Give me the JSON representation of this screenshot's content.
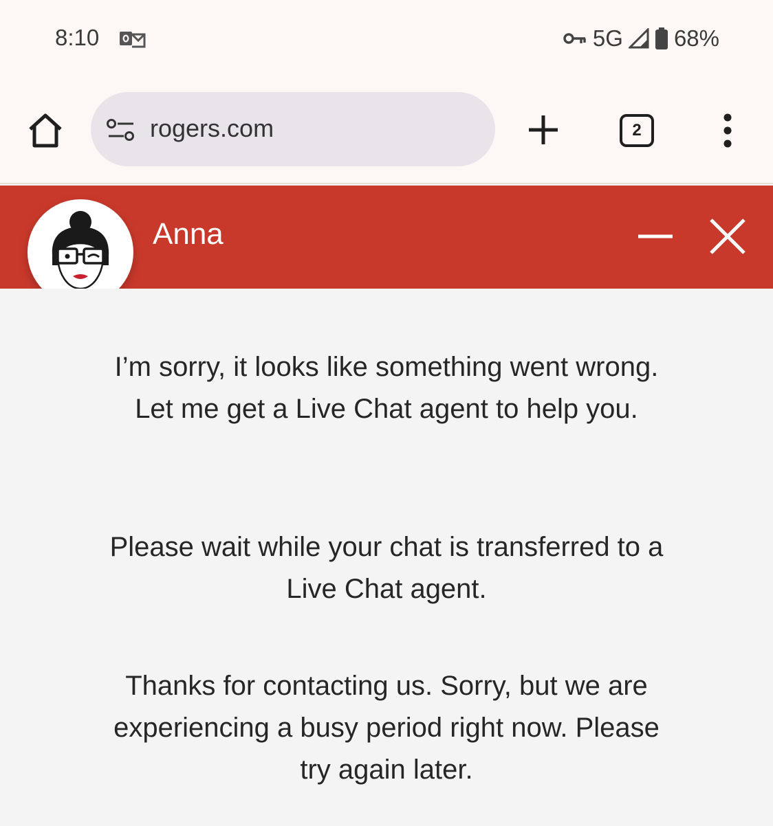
{
  "status_bar": {
    "time": "8:10",
    "network": "5G",
    "battery": "68%"
  },
  "browser": {
    "url": "rogers.com",
    "tab_count": "2",
    "icons": [
      "home-icon",
      "site-settings-icon",
      "plus-icon",
      "tabs-icon",
      "more-vertical-icon"
    ]
  },
  "chat": {
    "agent_name": "Anna",
    "header_color": "#c9392b",
    "messages": [
      "I’m sorry, it looks like something went wrong. Let me get a Live Chat agent to help you.",
      "Please wait while your chat is transferred to a Live Chat agent.",
      "Thanks for contacting us. Sorry, but we are experiencing a busy period right now. Please try again later."
    ]
  }
}
